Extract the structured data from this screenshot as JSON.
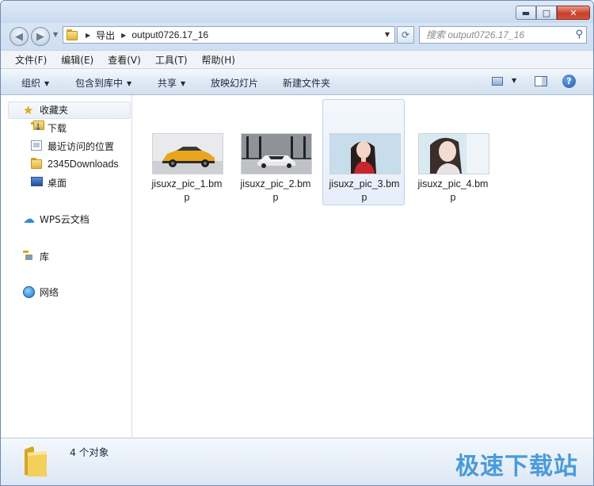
{
  "title_bar": {
    "minimize_label": "▬",
    "maximize_label": "□",
    "close_label": "✕"
  },
  "address_bar": {
    "crumbs": [
      "导出",
      "output0726.17_16"
    ]
  },
  "search": {
    "placeholder": "搜索 output0726.17_16"
  },
  "menu": {
    "items": [
      "文件(F)",
      "编辑(E)",
      "查看(V)",
      "工具(T)",
      "帮助(H)"
    ]
  },
  "command_bar": {
    "organize": "组织",
    "include_in_library": "包含到库中",
    "share": "共享",
    "slideshow": "放映幻灯片",
    "new_folder": "新建文件夹"
  },
  "nav_pane": {
    "favorites": "收藏夹",
    "downloads": "下载",
    "recent_places": "最近访问的位置",
    "downloads_2345": "2345Downloads",
    "desktop": "桌面",
    "wps_cloud": "WPS云文档",
    "libraries": "库",
    "network": "网络"
  },
  "files": [
    {
      "name": "jisuxz_pic_1.bmp",
      "thumb": "yellow-suv"
    },
    {
      "name": "jisuxz_pic_2.bmp",
      "thumb": "white-sports-car"
    },
    {
      "name": "jisuxz_pic_3.bmp",
      "thumb": "woman-red-dress",
      "selected": true
    },
    {
      "name": "jisuxz_pic_4.bmp",
      "thumb": "woman-portrait"
    }
  ],
  "status": {
    "item_count": "4 个对象"
  },
  "watermark": {
    "text": "极速下载站"
  },
  "colors": {
    "selection_border": "#bcd2ec",
    "watermark": "#4a9bd8",
    "accent": "#1f58a8"
  }
}
